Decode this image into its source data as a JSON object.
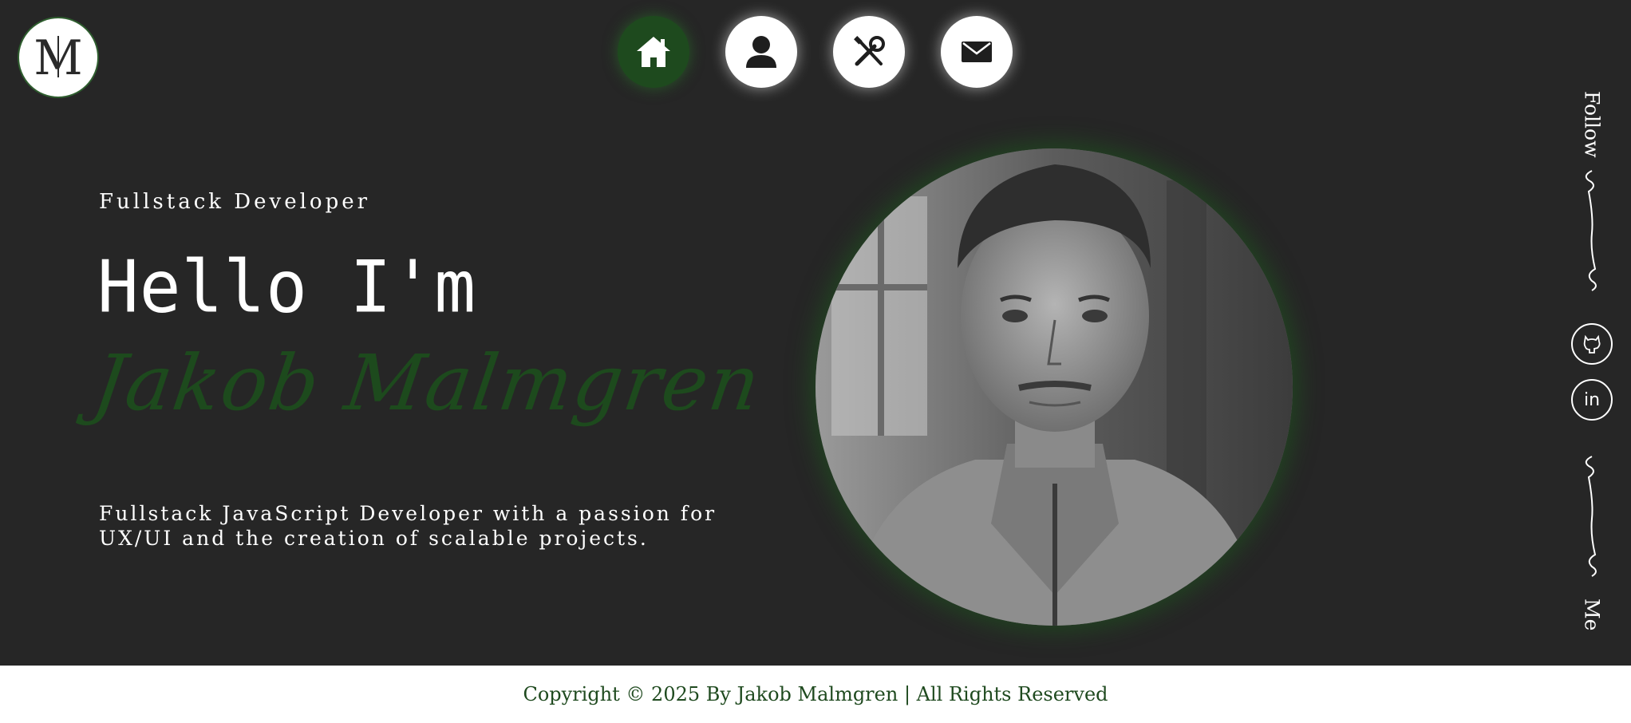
{
  "logo": {
    "monogram": "M",
    "monogram_alt": "J",
    "icon": "monogram-logo-icon"
  },
  "nav": {
    "items": [
      {
        "name": "home",
        "icon": "home-icon",
        "active": true
      },
      {
        "name": "about",
        "icon": "user-icon",
        "active": false
      },
      {
        "name": "skills",
        "icon": "tools-icon",
        "active": false
      },
      {
        "name": "contact",
        "icon": "mail-icon",
        "active": false
      }
    ]
  },
  "hero": {
    "subtitle": "Fullstack Developer",
    "greeting": "Hello I'm",
    "name": "Jakob Malmgren",
    "description": "Fullstack JavaScript Developer with a passion for UX/UI and the creation of scalable projects."
  },
  "social": {
    "top_label": "Follow",
    "bottom_label": "Me",
    "links": [
      {
        "name": "github",
        "icon": "github-icon"
      },
      {
        "name": "linkedin",
        "icon": "linkedin-icon",
        "text": "in"
      }
    ]
  },
  "footer": {
    "copyright": "Copyright © 2025 By Jakob Malmgren | All Rights Reserved"
  },
  "colors": {
    "background": "#262626",
    "accent": "#1d4a1d",
    "footer_bg": "#ffffff",
    "footer_text": "#1f4a1f"
  }
}
